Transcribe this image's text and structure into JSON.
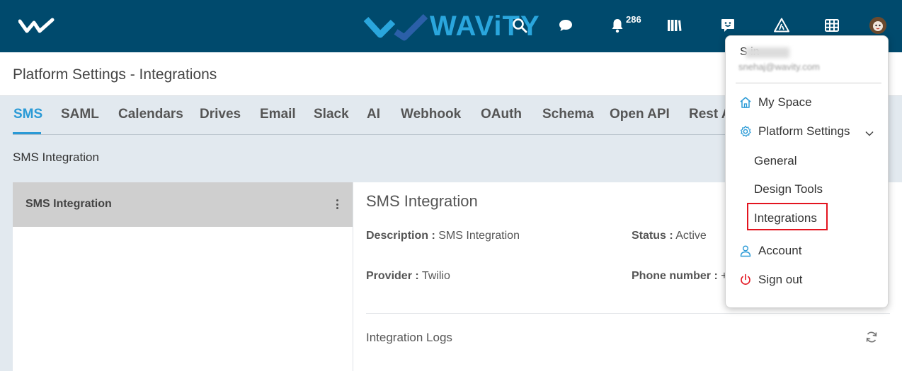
{
  "header": {
    "brand": "WAViTY",
    "notification_count": "286",
    "icons": [
      "logo-checkmark-icon",
      "search-icon",
      "chat-bubble-icon",
      "bell-icon",
      "library-books-icon",
      "feedback-smile-icon",
      "road-icon",
      "grid-table-icon",
      "user-avatar"
    ]
  },
  "page": {
    "title": "Platform Settings - Integrations"
  },
  "tabs": [
    "SMS",
    "SAML",
    "Calendars",
    "Drives",
    "Email",
    "Slack",
    "AI",
    "Webhook",
    "OAuth",
    "Schema",
    "Open API",
    "Rest A"
  ],
  "active_tab": "SMS",
  "section_label": "SMS Integration",
  "list": {
    "items": [
      {
        "label": "SMS Integration"
      }
    ]
  },
  "detail": {
    "title": "SMS Integration",
    "description_label": "Description :",
    "description_value": "SMS Integration",
    "status_label": "Status :",
    "status_value": "Active",
    "provider_label": "Provider :",
    "provider_value": "Twilio",
    "phone_label": "Phone number :",
    "phone_value": "+",
    "logs_label": "Integration Logs"
  },
  "user_menu": {
    "name": "S      in",
    "email": "snehaj@wavity.com",
    "items": {
      "my_space": "My Space",
      "platform_settings": "Platform Settings",
      "general": "General",
      "design_tools": "Design Tools",
      "integrations": "Integrations",
      "account": "Account",
      "sign_out": "Sign out"
    }
  },
  "colors": {
    "topbar": "#004a6d",
    "accent": "#2a9ad6",
    "highlight_box": "#e3141f",
    "signout_icon": "#e3141f"
  }
}
